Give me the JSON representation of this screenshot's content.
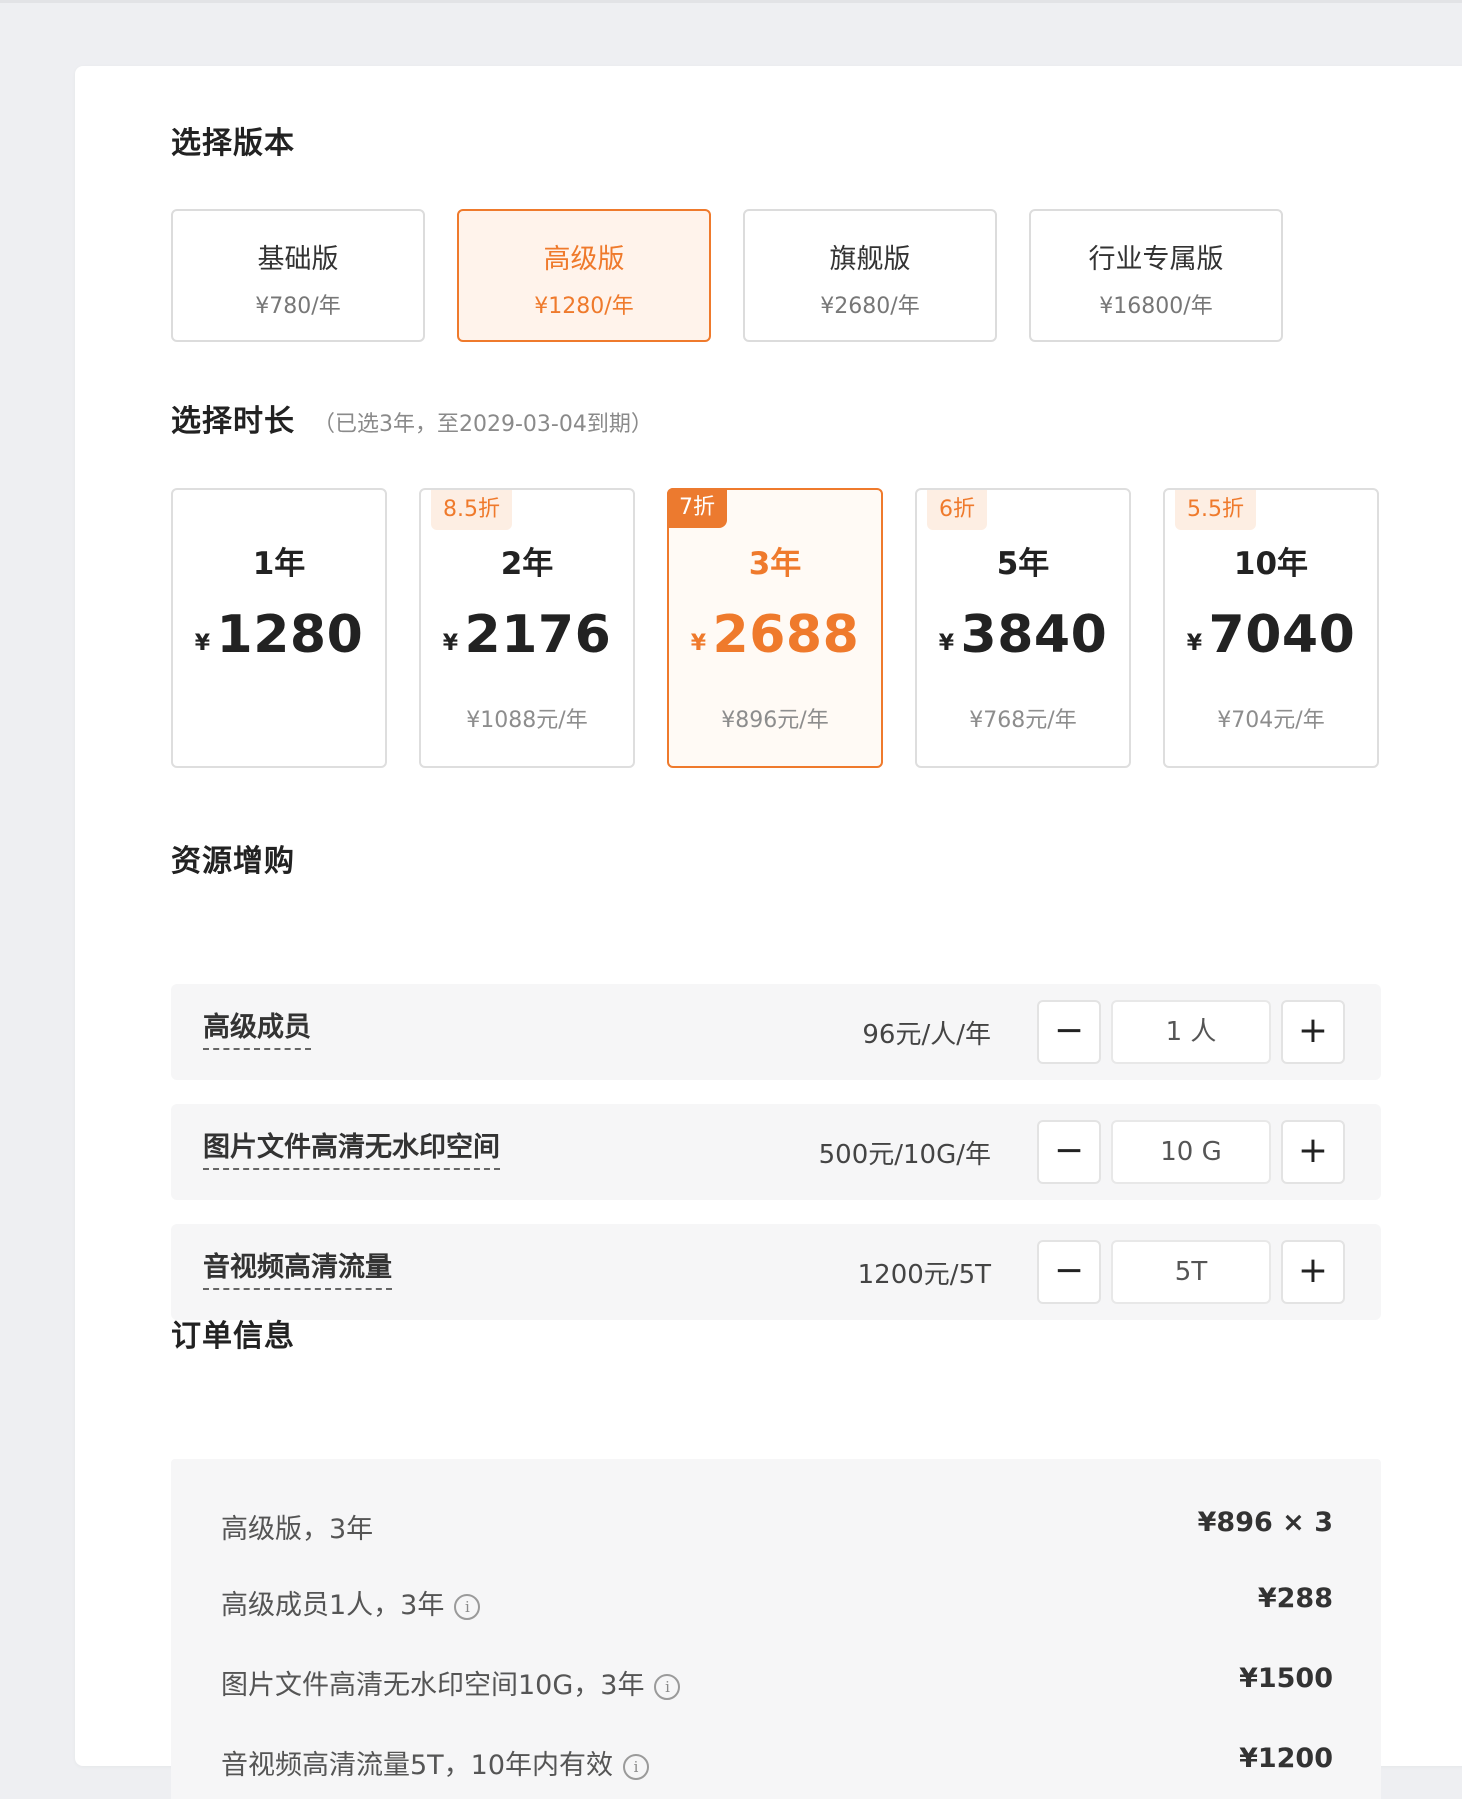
{
  "sections": {
    "version_title": "选择版本",
    "duration_title": "选择时长",
    "duration_subtitle": "（已选3年，至2029-03-04到期）",
    "addons_title": "资源增购",
    "order_title": "订单信息"
  },
  "versions": [
    {
      "name": "基础版",
      "price": "¥780/年",
      "selected": false
    },
    {
      "name": "高级版",
      "price": "¥1280/年",
      "selected": true
    },
    {
      "name": "旗舰版",
      "price": "¥2680/年",
      "selected": false
    },
    {
      "name": "行业专属版",
      "price": "¥16800/年",
      "selected": false
    }
  ],
  "durations": [
    {
      "years": "1年",
      "currency": "¥",
      "price": "1280",
      "per_year": "",
      "discount": "",
      "selected": false
    },
    {
      "years": "2年",
      "currency": "¥",
      "price": "2176",
      "per_year": "¥1088元/年",
      "discount": "8.5折",
      "selected": false
    },
    {
      "years": "3年",
      "currency": "¥",
      "price": "2688",
      "per_year": "¥896元/年",
      "discount": "7折",
      "selected": true
    },
    {
      "years": "5年",
      "currency": "¥",
      "price": "3840",
      "per_year": "¥768元/年",
      "discount": "6折",
      "selected": false
    },
    {
      "years": "10年",
      "currency": "¥",
      "price": "7040",
      "per_year": "¥704元/年",
      "discount": "5.5折",
      "selected": false
    }
  ],
  "addons": [
    {
      "name": "高级成员",
      "price": "96元/人/年",
      "value": "1 人",
      "minus": "−",
      "plus": "+"
    },
    {
      "name": "图片文件高清无水印空间",
      "price": "500元/10G/年",
      "value": "10 G",
      "minus": "−",
      "plus": "+"
    },
    {
      "name": "音视频高清流量",
      "price": "1200元/5T",
      "value": "5T",
      "minus": "−",
      "plus": "+"
    }
  ],
  "order": [
    {
      "label": "高级版，3年",
      "value": "¥896 × 3",
      "info": false
    },
    {
      "label": "高级成员1人，3年",
      "value": "¥288",
      "info": true
    },
    {
      "label": "图片文件高清无水印空间10G，3年",
      "value": "¥1500",
      "info": true
    },
    {
      "label": "音视频高清流量5T，10年内有效",
      "value": "¥1200",
      "info": true
    }
  ],
  "icons": {
    "info": "info-circle-icon",
    "info_glyph": "i"
  },
  "colors": {
    "accent": "#ef7a2c",
    "selected_bg": "#fff3eb",
    "panel_bg": "#f6f6f7",
    "page_bg": "#eeeff2"
  }
}
